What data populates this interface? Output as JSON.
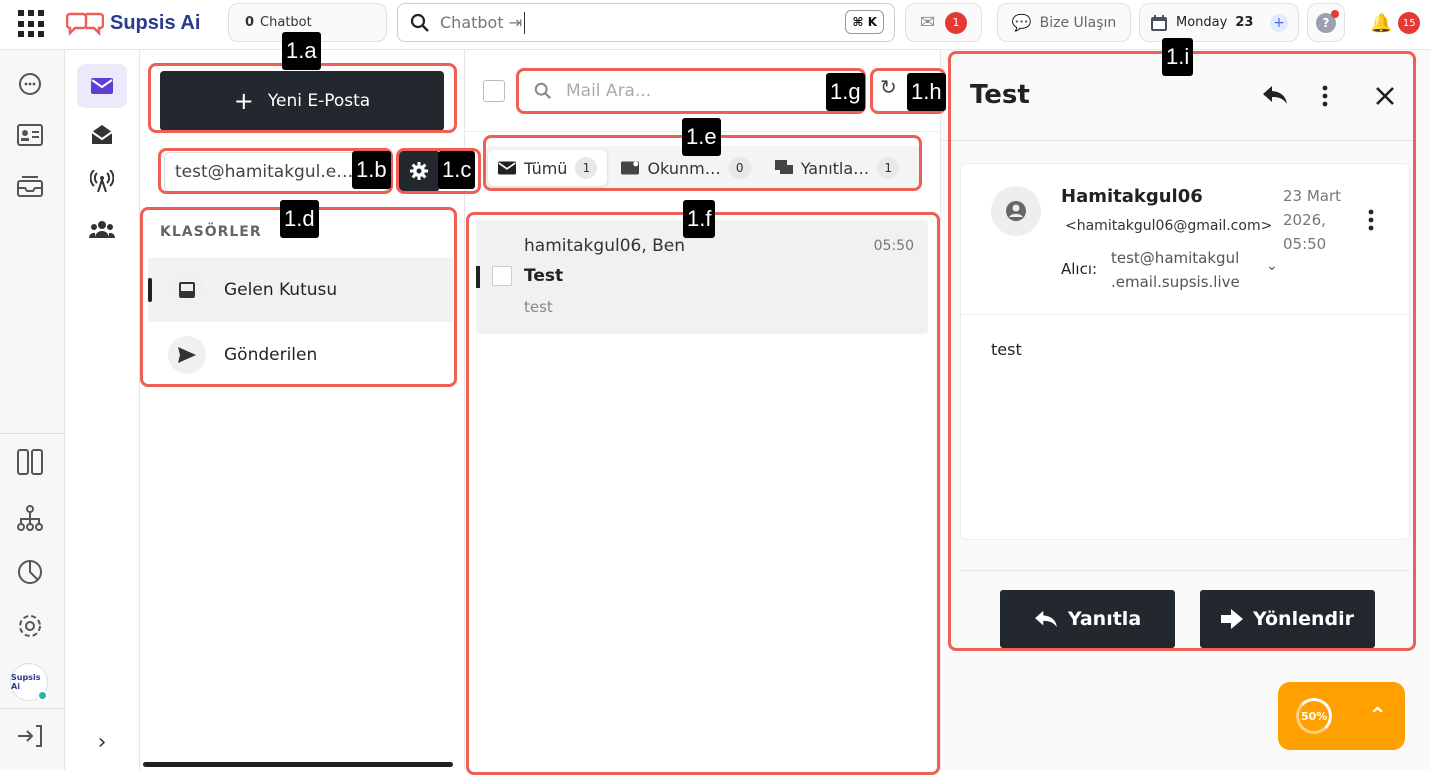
{
  "app": {
    "name": "Supsis Ai"
  },
  "topbar": {
    "chatbot_count": "0",
    "chatbot_label": "Chatbot",
    "search_text": "Chatbot ⇥",
    "shortcut": "⌘ K",
    "mail_badge": "1",
    "contact_label": "Bize Ulaşın",
    "day_label": "Monday",
    "day_number": "23",
    "help_glyph": "?",
    "notif_badge": "15"
  },
  "leftbar": {
    "avatar_text": "Supsis Ai",
    "icons": [
      "chat-icon",
      "contact-card-icon",
      "inbox-tray-icon",
      "layout-icon",
      "hierarchy-icon",
      "pie-chart-icon",
      "settings-icon",
      "logout-icon"
    ]
  },
  "folders": {
    "new_email_label": "Yeni E-Posta",
    "account": "test@hamitakgul.e…",
    "title": "KLASÖRLER",
    "items": [
      {
        "label": "Gelen Kutusu",
        "icon": "inbox-icon"
      },
      {
        "label": "Gönderilen",
        "icon": "send-icon"
      }
    ]
  },
  "list": {
    "search_placeholder": "Mail Ara...",
    "tabs": [
      {
        "label": "Tümü",
        "count": "1"
      },
      {
        "label": "Okunm…",
        "count": "0"
      },
      {
        "label": "Yanıtla…",
        "count": "1"
      }
    ],
    "mails": [
      {
        "from": "hamitakgul06, Ben",
        "time": "05:50",
        "subject": "Test",
        "preview": "test"
      }
    ]
  },
  "detail": {
    "title": "Test",
    "sender_name": "Hamitakgul06",
    "sender_email": "<hamitakgul06@gmail.com>",
    "date": "23 Mart 2026, 05:50",
    "to_label": "Alıcı:",
    "to_address": "test@hamitakgul .email.supsis.live",
    "body": "test",
    "reply_label": "Yanıtla",
    "forward_label": "Yönlendir"
  },
  "annotations": {
    "a": "1.a",
    "b": "1.b",
    "c": "1.c",
    "d": "1.d",
    "e": "1.e",
    "f": "1.f",
    "g": "1.g",
    "h": "1.h",
    "i": "1.i"
  },
  "progress": {
    "label": "50%",
    "value": 0.5
  },
  "colors": {
    "highlight": "#ef5f56",
    "brand": "#2a3a8c",
    "dark_button": "#23272e",
    "accent_orange": "#ffa000",
    "badge_red": "#e53935"
  }
}
